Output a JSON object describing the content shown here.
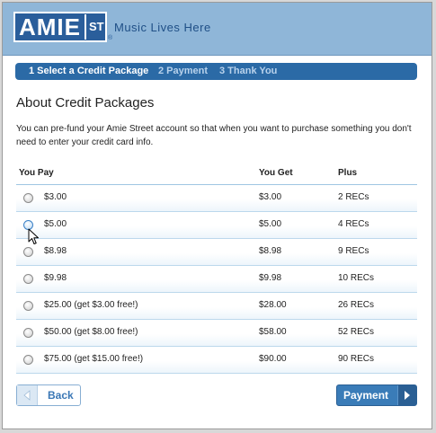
{
  "brand": {
    "logo_main": "AMIE",
    "logo_suffix": "ST",
    "tagline": "Music Lives Here"
  },
  "steps": [
    {
      "label": "1 Select a Credit Package"
    },
    {
      "label": "2 Payment"
    },
    {
      "label": "3 Thank You"
    }
  ],
  "page": {
    "title": "About Credit Packages",
    "intro": "You can pre-fund your Amie Street account so that when you want to purchase something you don't need to enter your credit card info."
  },
  "table": {
    "headers": {
      "pay": "You Pay",
      "get": "You Get",
      "plus": "Plus"
    },
    "rows": [
      {
        "pay": "$3.00",
        "get": "$3.00",
        "plus": "2 RECs"
      },
      {
        "pay": "$5.00",
        "get": "$5.00",
        "plus": "4 RECs"
      },
      {
        "pay": "$8.98",
        "get": "$8.98",
        "plus": "9 RECs"
      },
      {
        "pay": "$9.98",
        "get": "$9.98",
        "plus": "10 RECs"
      },
      {
        "pay": "$25.00 (get $3.00 free!)",
        "get": "$28.00",
        "plus": "26 RECs"
      },
      {
        "pay": "$50.00 (get $8.00 free!)",
        "get": "$58.00",
        "plus": "52 RECs"
      },
      {
        "pay": "$75.00 (get $15.00 free!)",
        "get": "$90.00",
        "plus": "90 RECs"
      }
    ]
  },
  "buttons": {
    "back": "Back",
    "payment": "Payment"
  },
  "colors": {
    "header": "#8fb6d8",
    "logo": "#2a5e9b",
    "steps_bar": "#2b6aa6",
    "button": "#3a7cb8"
  }
}
